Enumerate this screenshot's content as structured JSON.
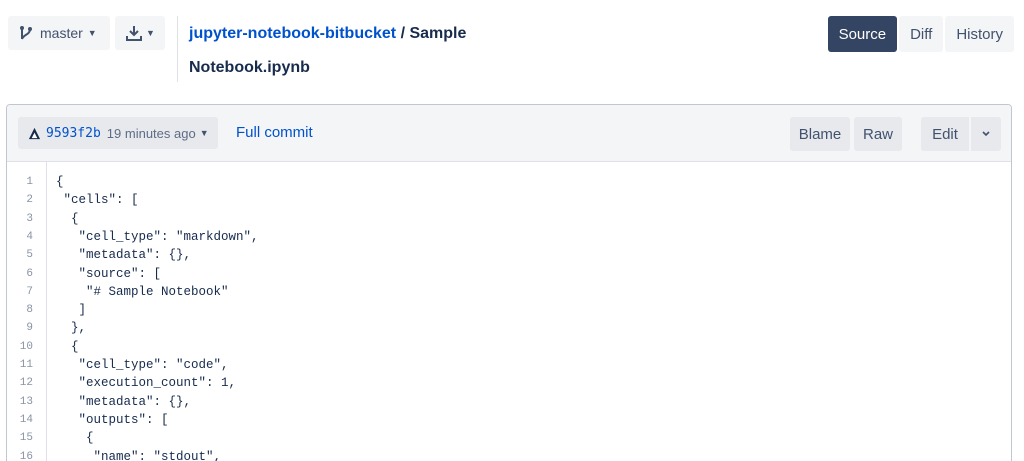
{
  "toolbar": {
    "branch_label": "master",
    "repo_link": "jupyter-notebook-bitbucket",
    "path_separator": "/",
    "filename_part1": "Sample",
    "filename_part2": "Notebook.ipynb",
    "view_tabs": [
      {
        "label": "Source",
        "active": true
      },
      {
        "label": "Diff",
        "active": false
      },
      {
        "label": "History",
        "active": false
      }
    ]
  },
  "file_header": {
    "commit_hash": "9593f2b",
    "commit_time": "19 minutes ago",
    "full_commit_label": "Full commit",
    "blame_label": "Blame",
    "raw_label": "Raw",
    "edit_label": "Edit"
  },
  "code_lines": [
    {
      "num": "1",
      "text": "{"
    },
    {
      "num": "2",
      "text": " \"cells\": ["
    },
    {
      "num": "3",
      "text": "  {"
    },
    {
      "num": "4",
      "text": "   \"cell_type\": \"markdown\","
    },
    {
      "num": "5",
      "text": "   \"metadata\": {},"
    },
    {
      "num": "6",
      "text": "   \"source\": ["
    },
    {
      "num": "7",
      "text": "    \"# Sample Notebook\""
    },
    {
      "num": "8",
      "text": "   ]"
    },
    {
      "num": "9",
      "text": "  },"
    },
    {
      "num": "10",
      "text": "  {"
    },
    {
      "num": "11",
      "text": "   \"cell_type\": \"code\","
    },
    {
      "num": "12",
      "text": "   \"execution_count\": 1,"
    },
    {
      "num": "13",
      "text": "   \"metadata\": {},"
    },
    {
      "num": "14",
      "text": "   \"outputs\": ["
    },
    {
      "num": "15",
      "text": "    {"
    },
    {
      "num": "16",
      "text": "     \"name\": \"stdout\","
    }
  ],
  "colors": {
    "link": "#0052cc",
    "active_tab": "#344563",
    "button_bg": "#f4f5f7"
  },
  "icons": [
    "branch-icon",
    "download-icon",
    "avatar-icon",
    "chevron-down-icon"
  ]
}
